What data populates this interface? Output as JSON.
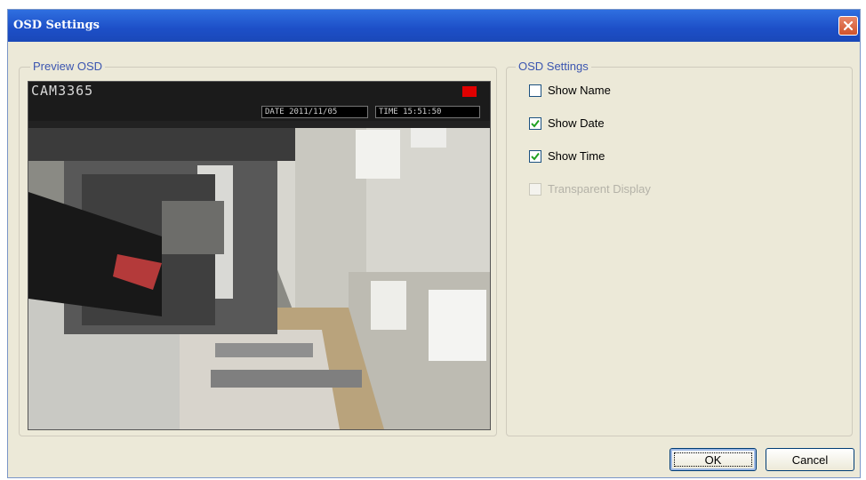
{
  "window": {
    "title": "OSD Settings"
  },
  "preview_group": {
    "label": "Preview OSD"
  },
  "preview": {
    "camera_name": "CAM3365",
    "date_text": "DATE 2011/11/05",
    "time_text": "TIME 15:51:50"
  },
  "settings_group": {
    "label": "OSD Settings"
  },
  "options": {
    "show_name": {
      "label": "Show Name",
      "checked": false
    },
    "show_date": {
      "label": "Show Date",
      "checked": true
    },
    "show_time": {
      "label": "Show Time",
      "checked": true
    },
    "transparent_display": {
      "label": "Transparent Display",
      "checked": false,
      "disabled": true
    }
  },
  "buttons": {
    "ok": "OK",
    "cancel": "Cancel"
  },
  "colors": {
    "titlebar": "#1d4fc7",
    "dialog_bg": "#ece9d8",
    "rec_indicator": "#e00000",
    "group_label": "#3b55b0"
  }
}
